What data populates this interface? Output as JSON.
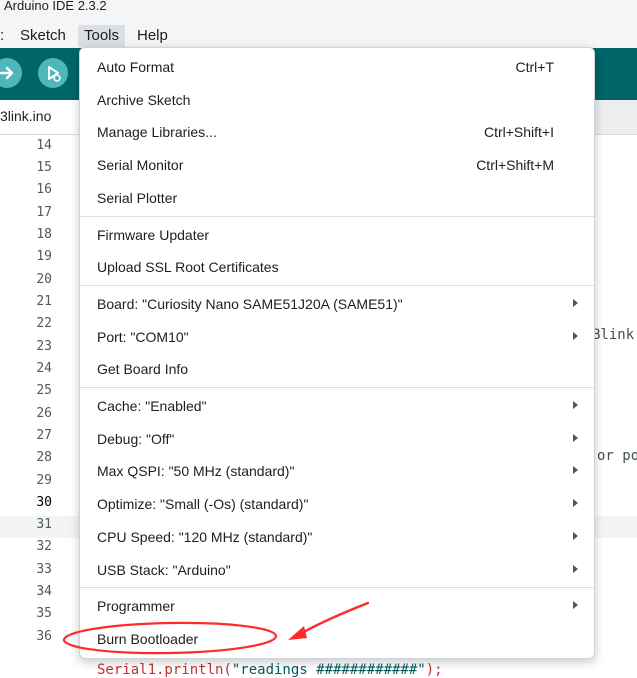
{
  "window": {
    "title": "Arduino IDE 2.3.2"
  },
  "menubar": {
    "prefix": ":",
    "items": [
      "Sketch",
      "Tools",
      "Help"
    ]
  },
  "toolbar": {
    "buttons": [
      "verify-icon",
      "upload-icon"
    ]
  },
  "tab": {
    "name": "3link.ino"
  },
  "editor": {
    "line_numbers": [
      "14",
      "15",
      "16",
      "17",
      "18",
      "19",
      "20",
      "21",
      "22",
      "23",
      "24",
      "25",
      "26",
      "27",
      "28",
      "29",
      "30",
      "31",
      "32",
      "33",
      "34",
      "35",
      "36"
    ],
    "current_line": "30",
    "fragment_22": "Blink",
    "fragment_27": "or po",
    "bottom_code_func": "Serial1.println(",
    "bottom_code_str": "\"readings ############\"",
    "bottom_code_end": ");"
  },
  "tools_menu": {
    "groups": [
      [
        {
          "label": "Auto Format",
          "shortcut": "Ctrl+T"
        },
        {
          "label": "Archive Sketch",
          "shortcut": ""
        },
        {
          "label": "Manage Libraries...",
          "shortcut": "Ctrl+Shift+I"
        },
        {
          "label": "Serial Monitor",
          "shortcut": "Ctrl+Shift+M"
        },
        {
          "label": "Serial Plotter",
          "shortcut": ""
        }
      ],
      [
        {
          "label": "Firmware Updater",
          "shortcut": ""
        },
        {
          "label": "Upload SSL Root Certificates",
          "shortcut": ""
        }
      ],
      [
        {
          "label": "Board: \"Curiosity Nano SAME51J20A (SAME51)\"",
          "submenu": true
        },
        {
          "label": "Port: \"COM10\"",
          "submenu": true
        },
        {
          "label": "Get Board Info",
          "submenu": false
        }
      ],
      [
        {
          "label": "Cache: \"Enabled\"",
          "submenu": true
        },
        {
          "label": "Debug: \"Off\"",
          "submenu": true
        },
        {
          "label": "Max QSPI: \"50 MHz (standard)\"",
          "submenu": true
        },
        {
          "label": "Optimize: \"Small (-Os) (standard)\"",
          "submenu": true
        },
        {
          "label": "CPU Speed: \"120 MHz (standard)\"",
          "submenu": true
        },
        {
          "label": "USB Stack: \"Arduino\"",
          "submenu": true
        }
      ],
      [
        {
          "label": "Programmer",
          "submenu": true
        },
        {
          "label": "Burn Bootloader",
          "submenu": false
        }
      ]
    ]
  },
  "annotation": {
    "color": "#ff2a2a",
    "target": "Burn Bootloader"
  }
}
